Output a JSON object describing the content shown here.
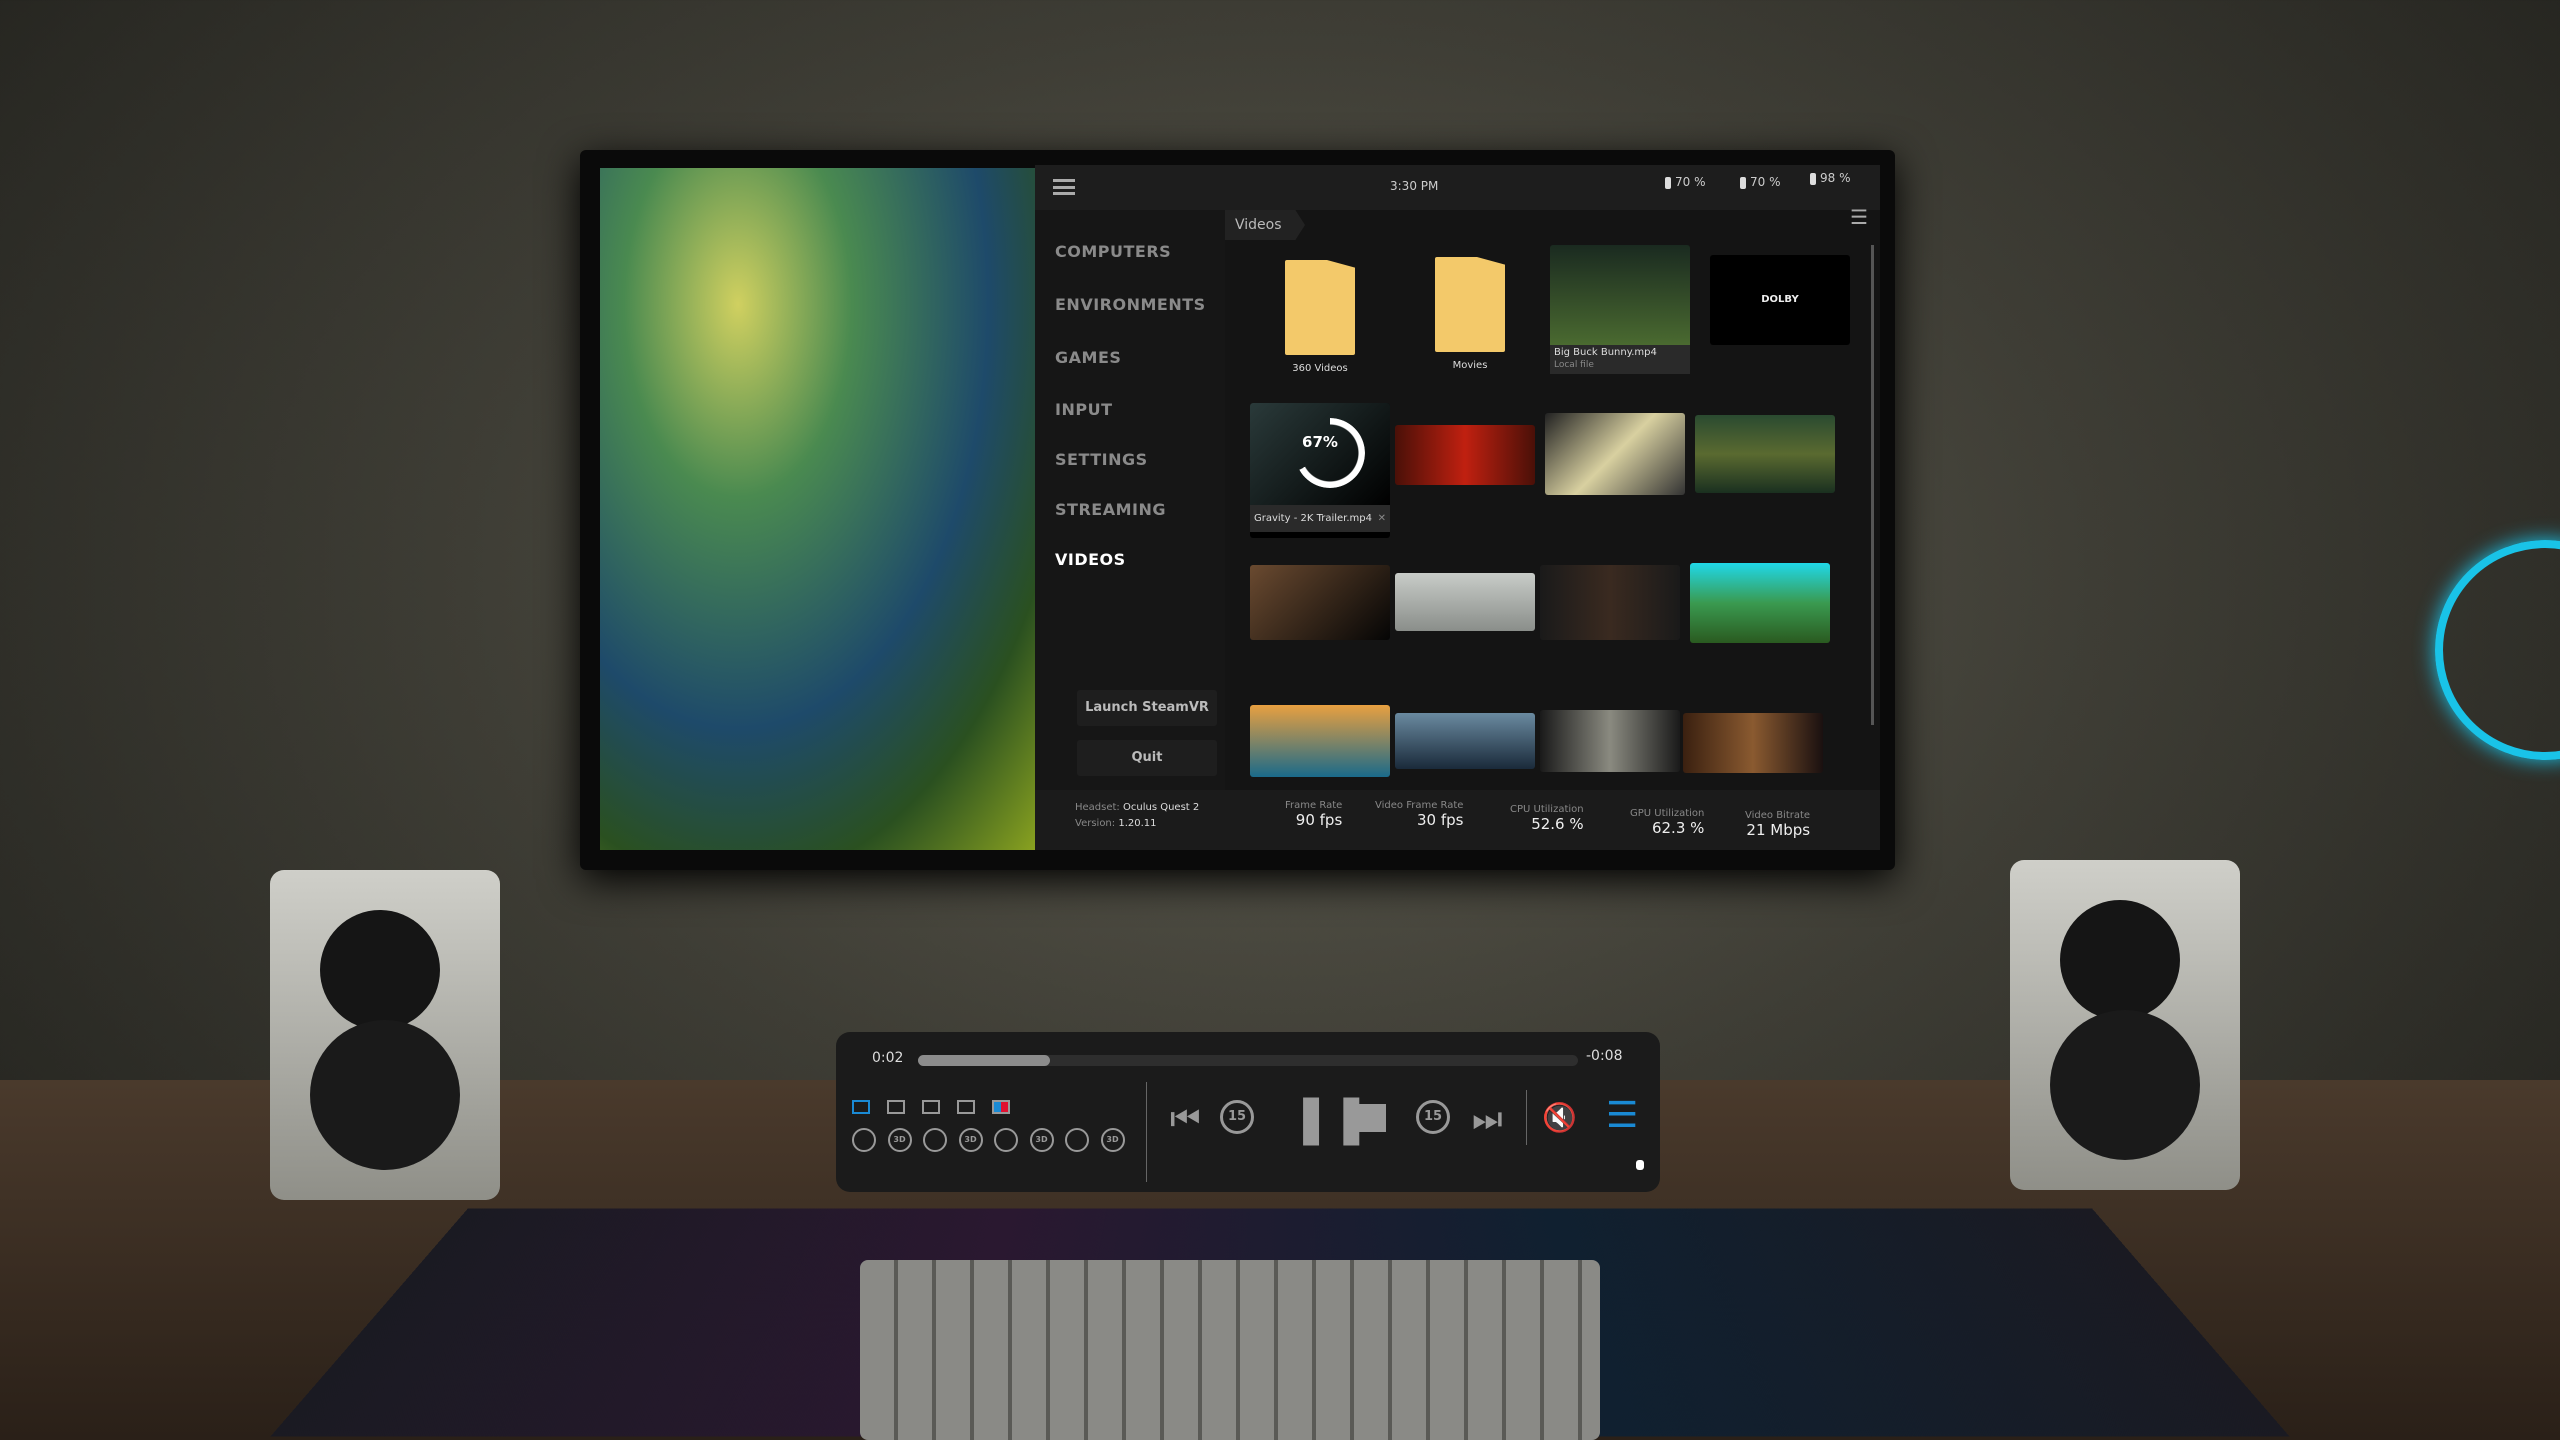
{
  "topbar": {
    "time": "3:30 PM",
    "batteries": [
      {
        "icon": "controller-battery-icon",
        "value": "70 %"
      },
      {
        "icon": "controller-battery-icon",
        "value": "70 %"
      },
      {
        "icon": "headset-battery-icon",
        "value": "98 %"
      }
    ]
  },
  "sidebar": {
    "items": [
      {
        "label": "COMPUTERS"
      },
      {
        "label": "ENVIRONMENTS"
      },
      {
        "label": "GAMES"
      },
      {
        "label": "INPUT"
      },
      {
        "label": "SETTINGS"
      },
      {
        "label": "STREAMING"
      },
      {
        "label": "VIDEOS",
        "active": true
      }
    ],
    "launch_label": "Launch SteamVR",
    "quit_label": "Quit"
  },
  "breadcrumb": {
    "current": "Videos"
  },
  "grid": {
    "folders": [
      {
        "name": "360 Videos"
      },
      {
        "name": "Movies"
      }
    ],
    "playing": {
      "title": "Big Buck Bunny.mp4",
      "subtitle": "Local file"
    },
    "dolby": "DOLBY",
    "downloading": {
      "title": "Gravity - 2K Trailer.mp4",
      "progress": "67%"
    }
  },
  "stats": {
    "headset_label": "Headset:",
    "headset": "Oculus Quest 2",
    "version_label": "Version:",
    "version": "1.20.11",
    "items": [
      {
        "label": "Frame Rate",
        "value": "90 fps"
      },
      {
        "label": "Video Frame Rate",
        "value": "30 fps"
      },
      {
        "label": "CPU Utilization",
        "value": "52.6 %"
      },
      {
        "label": "GPU Utilization",
        "value": "62.3 %"
      },
      {
        "label": "Video Bitrate",
        "value": "21 Mbps"
      }
    ]
  },
  "player": {
    "elapsed": "0:02",
    "remaining": "-0:08",
    "progress_percent": 20,
    "skip_back": "15",
    "skip_forward": "15",
    "accent": "#1a8ad4",
    "circle_modes": [
      "",
      "3D",
      "",
      "3D",
      "",
      "3D",
      "",
      "3D"
    ]
  }
}
